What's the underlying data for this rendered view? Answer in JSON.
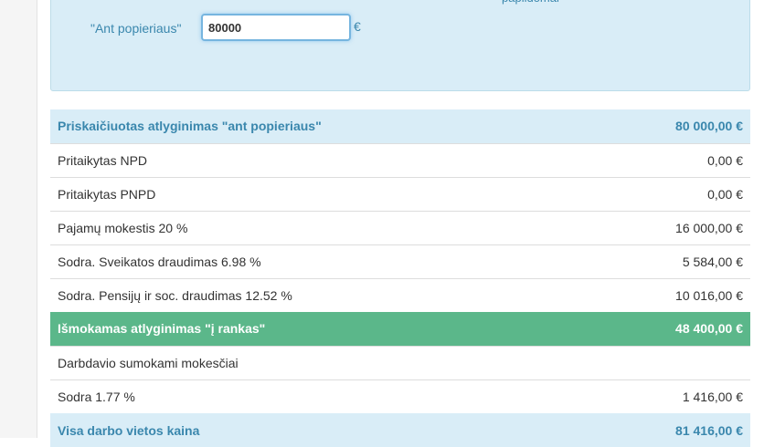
{
  "form": {
    "hint": "papildomai",
    "label": "\"Ant popieriaus\"",
    "input_value": "80000",
    "currency": "€"
  },
  "colors": {
    "info_bg": "#d9edf7",
    "info_text": "#3a87ad",
    "success_bg": "#5bb78a"
  },
  "rows": [
    {
      "label": "Priskaičiuotas atlyginimas \"ant popieriaus\"",
      "value": "80 000,00 €"
    },
    {
      "label": "Pritaikytas NPD",
      "value": "0,00 €"
    },
    {
      "label": "Pritaikytas PNPD",
      "value": "0,00 €"
    },
    {
      "label": "Pajamų mokestis 20 %",
      "value": "16 000,00 €"
    },
    {
      "label": "Sodra. Sveikatos draudimas 6.98 %",
      "value": "5 584,00 €"
    },
    {
      "label": "Sodra. Pensijų ir soc. draudimas 12.52 %",
      "value": "10 016,00 €"
    },
    {
      "label": "Išmokamas atlyginimas \"į rankas\"",
      "value": "48 400,00 €"
    },
    {
      "label": "Darbdavio sumokami mokesčiai",
      "value": ""
    },
    {
      "label": "Sodra 1.77 %",
      "value": "1 416,00 €"
    },
    {
      "label": "Visa darbo vietos kaina",
      "value": "81 416,00 €"
    }
  ]
}
